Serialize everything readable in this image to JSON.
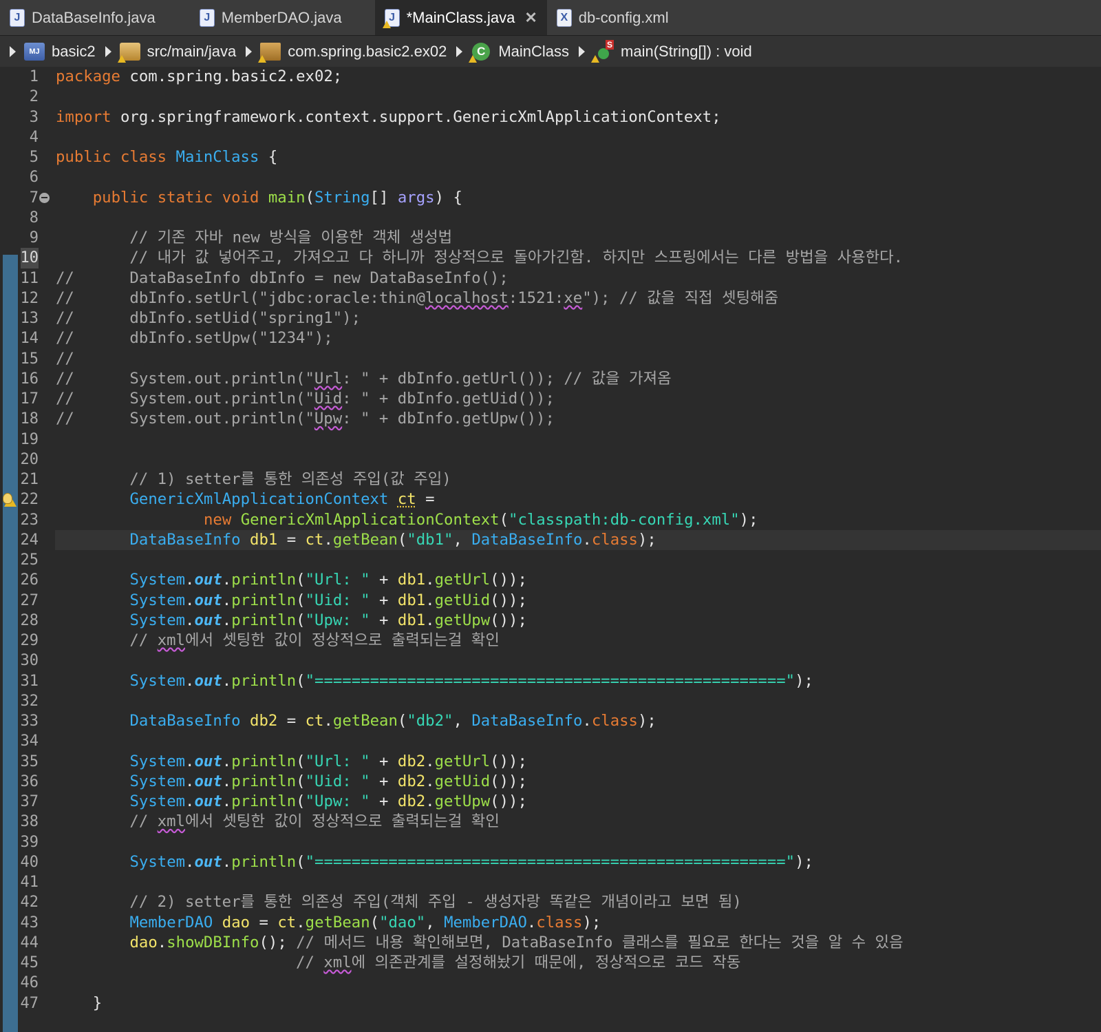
{
  "tabs": [
    {
      "label": "DataBaseInfo.java",
      "icon": "java-file-icon",
      "active": false
    },
    {
      "label": "MemberDAO.java",
      "icon": "java-file-icon",
      "active": false
    },
    {
      "label": "*MainClass.java",
      "icon": "java-file-warning-icon",
      "active": true
    },
    {
      "label": "db-config.xml",
      "icon": "xml-file-icon",
      "active": false
    }
  ],
  "breadcrumb": [
    {
      "label": "basic2",
      "icon": "java-project-icon"
    },
    {
      "label": "src/main/java",
      "icon": "source-folder-icon"
    },
    {
      "label": "com.spring.basic2.ex02",
      "icon": "package-icon"
    },
    {
      "label": "MainClass",
      "icon": "class-icon"
    },
    {
      "label": "main(String[]) : void",
      "icon": "static-method-icon"
    }
  ],
  "editor": {
    "current_line": 24,
    "lines": [
      {
        "n": "1",
        "t": "package com.spring.basic2.ex02;"
      },
      {
        "n": "2",
        "t": ""
      },
      {
        "n": "3",
        "t": "import org.springframework.context.support.GenericXmlApplicationContext;"
      },
      {
        "n": "4",
        "t": ""
      },
      {
        "n": "5",
        "t": "public class MainClass {"
      },
      {
        "n": "6",
        "t": ""
      },
      {
        "n": "7",
        "t": "    public static void main(String[] args) {"
      },
      {
        "n": "8",
        "t": ""
      },
      {
        "n": "9",
        "t": "        // 기존 자바 new 방식을 이용한 객체 생성법"
      },
      {
        "n": "10",
        "t": "        // 내가 값 넣어주고, 가져오고 다 하니까 정상적으로 돌아가긴함. 하지만 스프링에서는 다른 방법을 사용한다."
      },
      {
        "n": "11",
        "t": "//      DataBaseInfo dbInfo = new DataBaseInfo();"
      },
      {
        "n": "12",
        "t": "//      dbInfo.setUrl(\"jdbc:oracle:thin@localhost:1521:xe\"); // 값을 직접 셋팅해줌"
      },
      {
        "n": "13",
        "t": "//      dbInfo.setUid(\"spring1\");"
      },
      {
        "n": "14",
        "t": "//      dbInfo.setUpw(\"1234\");"
      },
      {
        "n": "15",
        "t": "//"
      },
      {
        "n": "16",
        "t": "//      System.out.println(\"Url: \" + dbInfo.getUrl()); // 값을 가져옴"
      },
      {
        "n": "17",
        "t": "//      System.out.println(\"Uid: \" + dbInfo.getUid());"
      },
      {
        "n": "18",
        "t": "//      System.out.println(\"Upw: \" + dbInfo.getUpw());"
      },
      {
        "n": "19",
        "t": ""
      },
      {
        "n": "20",
        "t": ""
      },
      {
        "n": "21",
        "t": "        // 1) setter를 통한 의존성 주입(값 주입)"
      },
      {
        "n": "22",
        "t": "        GenericXmlApplicationContext ct ="
      },
      {
        "n": "23",
        "t": "                new GenericXmlApplicationContext(\"classpath:db-config.xml\");"
      },
      {
        "n": "24",
        "t": "        DataBaseInfo db1 = ct.getBean(\"db1\", DataBaseInfo.class);"
      },
      {
        "n": "25",
        "t": ""
      },
      {
        "n": "26",
        "t": "        System.out.println(\"Url: \" + db1.getUrl());"
      },
      {
        "n": "27",
        "t": "        System.out.println(\"Uid: \" + db1.getUid());"
      },
      {
        "n": "28",
        "t": "        System.out.println(\"Upw: \" + db1.getUpw());"
      },
      {
        "n": "29",
        "t": "        // xml에서 셋팅한 값이 정상적으로 출력되는걸 확인"
      },
      {
        "n": "30",
        "t": ""
      },
      {
        "n": "31",
        "t": "        System.out.println(\"===================================================\");"
      },
      {
        "n": "32",
        "t": ""
      },
      {
        "n": "33",
        "t": "        DataBaseInfo db2 = ct.getBean(\"db2\", DataBaseInfo.class);"
      },
      {
        "n": "34",
        "t": ""
      },
      {
        "n": "35",
        "t": "        System.out.println(\"Url: \" + db2.getUrl());"
      },
      {
        "n": "36",
        "t": "        System.out.println(\"Uid: \" + db2.getUid());"
      },
      {
        "n": "37",
        "t": "        System.out.println(\"Upw: \" + db2.getUpw());"
      },
      {
        "n": "38",
        "t": "        // xml에서 셋팅한 값이 정상적으로 출력되는걸 확인"
      },
      {
        "n": "39",
        "t": ""
      },
      {
        "n": "40",
        "t": "        System.out.println(\"===================================================\");"
      },
      {
        "n": "41",
        "t": ""
      },
      {
        "n": "42",
        "t": "        // 2) setter를 통한 의존성 주입(객체 주입 - 생성자랑 똑같은 개념이라고 보면 됨)"
      },
      {
        "n": "43",
        "t": "        MemberDAO dao = ct.getBean(\"dao\", MemberDAO.class);"
      },
      {
        "n": "44",
        "t": "        dao.showDBInfo(); // 메서드 내용 확인해보면, DataBaseInfo 클래스를 필요로 한다는 것을 알 수 있음"
      },
      {
        "n": "45",
        "t": "                          // xml에 의존관계를 설정해놨기 때문에, 정상적으로 코드 작동"
      },
      {
        "n": "46",
        "t": ""
      },
      {
        "n": "47",
        "t": "    }"
      }
    ]
  },
  "colors": {
    "keyword": "#e77b33",
    "comment": "#a7a7a7",
    "type": "#3aaef0",
    "method": "#9ee04a",
    "string": "#37d7b5",
    "field": "#4db8f5",
    "local": "#f3e46a",
    "param": "#a6a2ff"
  }
}
